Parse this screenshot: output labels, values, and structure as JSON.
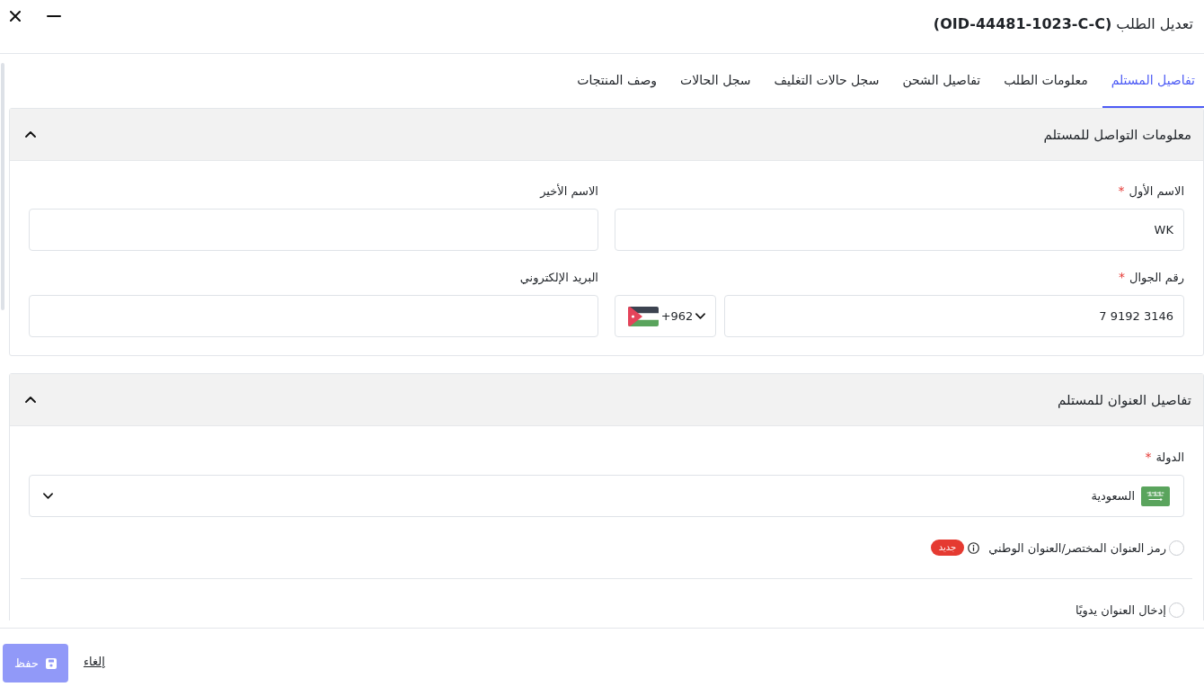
{
  "window": {
    "title": "تعديل الطلب **(OID-44481-1023-C-C)**"
  },
  "tabs": [
    {
      "label": "تفاصيل المستلم",
      "selected": true
    },
    {
      "label": "معلومات الطلب",
      "selected": false
    },
    {
      "label": "تفاصيل الشحن",
      "selected": false
    },
    {
      "label": "سجل حالات التغليف",
      "selected": false
    },
    {
      "label": "سجل الحالات",
      "selected": false
    },
    {
      "label": "وصف المنتجات",
      "selected": false
    }
  ],
  "sections": [
    {
      "title": "معلومات التواصل للمستلم",
      "expanded": true,
      "fields": [
        {
          "kind": "text",
          "label": "الاسم الأول",
          "required_mark": "*",
          "value": "WK"
        },
        {
          "kind": "text",
          "label": "الاسم الأخير"
        },
        {
          "kind": "phone",
          "label": "رقم الجوال",
          "required_mark": "*",
          "country_code": "+962",
          "value": "7 9192 3146"
        },
        {
          "kind": "text",
          "label": "البريد الإلكتروني"
        }
      ]
    },
    {
      "title": "تفاصيل العنوان للمستلم",
      "expanded": true,
      "fields": [
        {
          "kind": "select",
          "label": "الدولة",
          "required_mark": "*",
          "value": "السعودية"
        }
      ],
      "options": [
        {
          "label": "رمز العنوان المختصر/العنوان الوطني",
          "selected": false,
          "info": true,
          "badge": "جديد"
        },
        {
          "label": "إدخال العنوان يدويًا",
          "selected": false,
          "info": false
        }
      ]
    }
  ],
  "footer": {
    "save": {
      "label": "حفظ",
      "disabled": true
    },
    "cancel": "إلغاء"
  }
}
